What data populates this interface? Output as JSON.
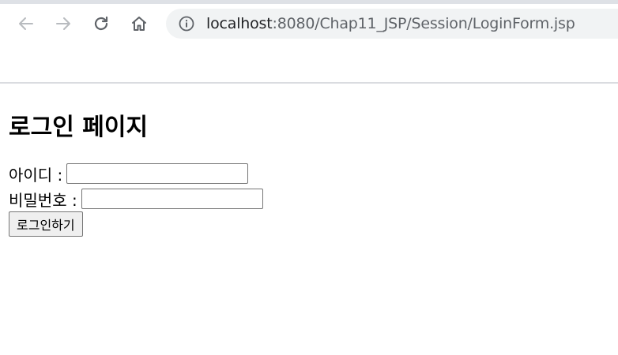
{
  "browser": {
    "url_host": "localhost",
    "url_rest": ":8080/Chap11_JSP/Session/LoginForm.jsp",
    "icons": {
      "back": "arrow-left-icon",
      "forward": "arrow-right-icon",
      "reload": "reload-icon",
      "home": "home-icon",
      "site_info": "info-icon"
    }
  },
  "page": {
    "title": "로그인 페이지",
    "id_label": "아이디 :",
    "id_value": "",
    "password_label": "비밀번호 :",
    "password_value": "",
    "submit_label": "로그인하기"
  }
}
